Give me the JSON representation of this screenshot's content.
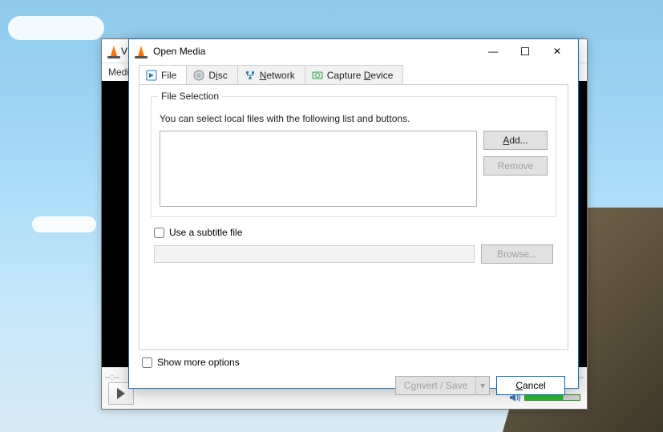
{
  "background_main": {
    "title_partial": "V",
    "menubar_partial": "Medi",
    "close_glyph": "✕",
    "time_left": "--:--",
    "time_right": "--:--"
  },
  "dialog": {
    "title": "Open Media",
    "minimize": "—",
    "close": "✕",
    "tabs": {
      "file": "File",
      "disc_pre": "D",
      "disc_u": "i",
      "disc_post": "sc",
      "network_u": "N",
      "network_post": "etwork",
      "capture_pre": "Capture ",
      "capture_u": "D",
      "capture_post": "evice"
    },
    "fieldset": {
      "legend": "File Selection",
      "help": "You can select local files with the following list and buttons.",
      "add_u": "A",
      "add_post": "dd...",
      "remove": "Remove"
    },
    "subtitle": {
      "label": "Use a subtitle file",
      "path": "",
      "browse": "Browse..."
    },
    "show_more": "Show more options",
    "convert_pre": "C",
    "convert_u": "o",
    "convert_post": "nvert / Save",
    "caret": "▾",
    "cancel_u": "C",
    "cancel_post": "ancel"
  }
}
